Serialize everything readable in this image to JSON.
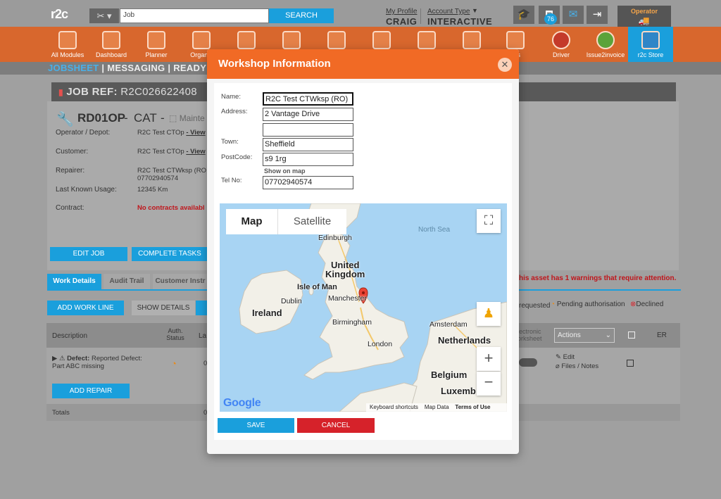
{
  "topbar": {
    "logo": "r2c",
    "tools_icon": "tools-icon",
    "search_value": "Job",
    "search_button": "SEARCH",
    "my_profile_link": "My Profile",
    "my_profile_value": "CRAIG",
    "account_type_link": "Account Type",
    "account_type_value": "INTERACTIVE",
    "notification_count": "76",
    "operator_badge": "Operator"
  },
  "modules": [
    {
      "label": "All Modules",
      "icon": "grid-icon"
    },
    {
      "label": "Dashboard",
      "icon": "gauge-icon"
    },
    {
      "label": "Planner",
      "icon": "calendar-icon"
    },
    {
      "label": "Organis",
      "icon": "building-icon"
    },
    {
      "label": "",
      "icon": "folder-icon"
    },
    {
      "label": "",
      "icon": "truck-icon"
    },
    {
      "label": "",
      "icon": "tools-icon"
    },
    {
      "label": "",
      "icon": "clipboard-icon"
    },
    {
      "label": "",
      "icon": "warning-icon"
    },
    {
      "label": "",
      "icon": "chart-icon"
    },
    {
      "label": "ves",
      "icon": "archive-icon"
    },
    {
      "label": "Driver",
      "icon": "driver-icon"
    },
    {
      "label": "Issue2invoice",
      "icon": "i2i-icon"
    },
    {
      "label": "r2c Store",
      "icon": "store-icon"
    }
  ],
  "subnav": {
    "items": [
      "JOBSHEET",
      "|",
      "MESSAGING",
      "|",
      "READY"
    ]
  },
  "job": {
    "ref_label": "JOB REF:",
    "ref_value": "R2C026622408",
    "vehicle": "RD01OP",
    "vehicle_sep": "-",
    "category": "CAT",
    "maint": "Mainte",
    "rows": [
      {
        "label": "Operator / Depot:",
        "value": "R2C Test CTOp",
        "link": "- View"
      },
      {
        "label": "Customer:",
        "value": "R2C Test CTOp",
        "link": "- View"
      },
      {
        "label": "Repairer:",
        "value": "R2C Test CTWksp (RO",
        "value2": "07702940574"
      },
      {
        "label": "Last Known Usage:",
        "value": "12345 Km"
      },
      {
        "label": "Contract:",
        "value": "No contracts availabl"
      }
    ],
    "edit_job": "EDIT JOB",
    "complete_tasks": "COMPLETE TASKS"
  },
  "tabs": [
    "Work Details",
    "Audit Trail",
    "Customer Instr"
  ],
  "warning_text": "his asset has 1 warnings that require attention.",
  "work": {
    "add_work_line": "ADD WORK LINE",
    "show_details": "SHOW DETAILS",
    "legend_requested": "requested",
    "legend_pending": "Pending authorisation",
    "legend_declined": "Declined",
    "col_description": "Description",
    "col_auth": "Auth. Status",
    "col_la": "La",
    "col_worksheet": "lectronic orksheet",
    "col_actions": "Actions",
    "col_er": "ER",
    "defect_label": "Defect:",
    "defect_text": "Reported Defect: Part ABC missing",
    "row_value": "0",
    "edit": "Edit",
    "files_notes": "Files / Notes",
    "add_repair": "ADD REPAIR",
    "totals": "Totals",
    "totals_value": "0"
  },
  "modal": {
    "title": "Workshop Information",
    "fields": {
      "name_label": "Name:",
      "name_value": "R2C Test CTWksp (RO)",
      "address_label": "Address:",
      "address1": "2 Vantage Drive",
      "address2": "",
      "town_label": "Town:",
      "town_value": "Sheffield",
      "postcode_label": "PostCode:",
      "postcode_value": "s9 1rg",
      "show_on_map": "Show on map",
      "tel_label": "Tel No:",
      "tel_value": "07702940574"
    },
    "map": {
      "type_map": "Map",
      "type_satellite": "Satellite",
      "labels": {
        "north_sea": "North Sea",
        "edinburgh": "Edinburgh",
        "uk1": "United",
        "uk2": "Kingdom",
        "isle_of_man": "Isle of Man",
        "dublin": "Dublin",
        "ireland": "Ireland",
        "manchester": "Manchester",
        "birmingham": "Birmingham",
        "london": "London",
        "amsterdam": "Amsterdam",
        "netherlands": "Netherlands",
        "belgium": "Belgium",
        "luxemb": "Luxemb"
      },
      "google": "Google",
      "footer_keyboard": "Keyboard shortcuts",
      "footer_data": "Map Data",
      "footer_terms": "Terms of Use"
    },
    "save": "SAVE",
    "cancel": "CANCEL"
  },
  "colors": {
    "accent_orange": "#f16a25",
    "accent_blue": "#1a9fdc",
    "cancel_red": "#d6222a"
  }
}
